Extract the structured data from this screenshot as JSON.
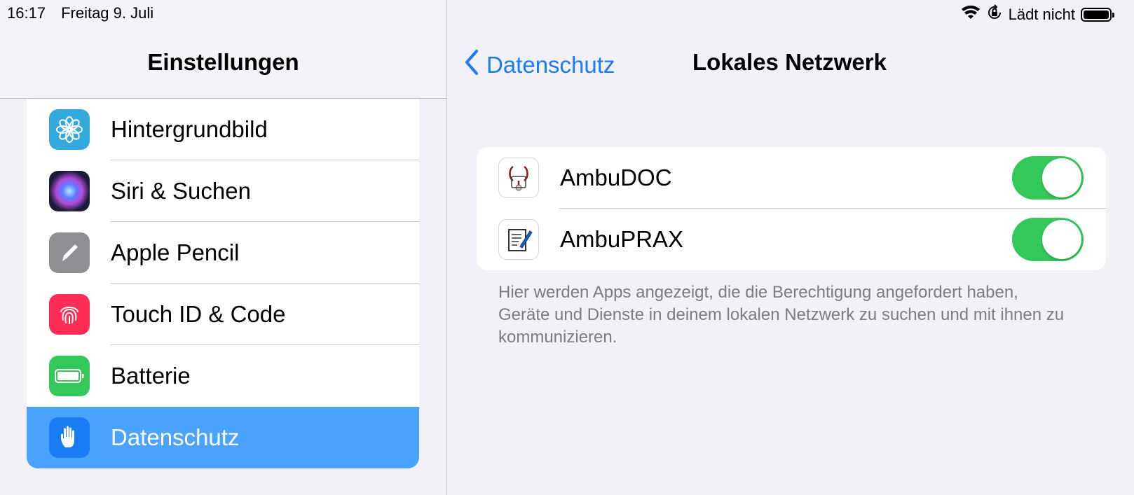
{
  "status_bar": {
    "time": "16:17",
    "date": "Freitag 9. Juli",
    "charging": "Lädt nicht",
    "icons": [
      "wifi-icon",
      "rotation-lock-icon",
      "battery-icon"
    ]
  },
  "sidebar": {
    "title": "Einstellungen",
    "items": [
      {
        "label": "Hintergrundbild",
        "icon": "flower-icon",
        "color": "#34aadc"
      },
      {
        "label": "Siri & Suchen",
        "icon": "siri-icon",
        "color": "#1c1c3a"
      },
      {
        "label": "Apple Pencil",
        "icon": "pencil-icon",
        "color": "#8e8e93"
      },
      {
        "label": "Touch ID & Code",
        "icon": "fingerprint-icon",
        "color": "#ff2d55"
      },
      {
        "label": "Batterie",
        "icon": "battery-icon",
        "color": "#34c759"
      },
      {
        "label": "Datenschutz",
        "icon": "hand-icon",
        "color": "#1a7cf5",
        "selected": true
      }
    ]
  },
  "detail": {
    "back_label": "Datenschutz",
    "title": "Lokales Netzwerk",
    "apps": [
      {
        "name": "AmbuDOC",
        "enabled": true
      },
      {
        "name": "AmbuPRAX",
        "enabled": true
      }
    ],
    "footnote": "Hier werden Apps angezeigt, die die Berechtigung angefordert haben, Geräte und Dienste in deinem lokalen Netzwerk zu suchen und mit ihnen zu kommunizieren."
  },
  "colors": {
    "accent": "#1a7cf5",
    "toggle_on": "#34c759",
    "selection": "#4aa3ff"
  }
}
